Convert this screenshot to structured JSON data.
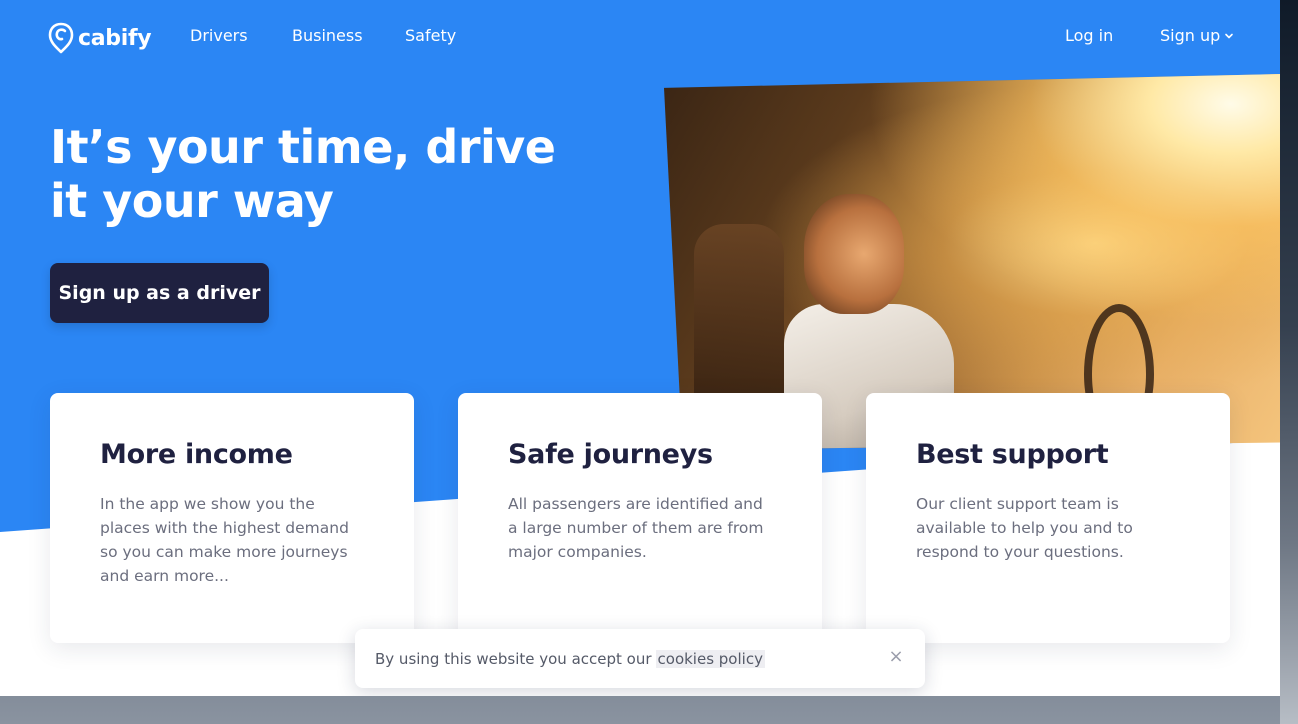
{
  "nav": {
    "logo_text": "cabify",
    "links": [
      "Drivers",
      "Business",
      "Safety"
    ],
    "login": "Log in",
    "signup": "Sign up"
  },
  "hero": {
    "title_line1": "It’s your time, drive",
    "title_line2": "it your way",
    "cta": "Sign up as a driver"
  },
  "cards": [
    {
      "title": "More income",
      "body": "In the app we show you the places with the highest demand so you can make more journeys and earn more..."
    },
    {
      "title": "Safe journeys",
      "body": "All passengers are identified and a large number of them are from major companies."
    },
    {
      "title": "Best support",
      "body": "Our client support team is available to help you and to respond to your questions."
    }
  ],
  "cookie": {
    "text": "By using this website you accept our",
    "link": "cookies policy",
    "close": "×"
  },
  "colors": {
    "brand_blue": "#2b86f4",
    "cta_dark": "#1f2140"
  },
  "icons": {
    "logo": "cabify-logo-icon",
    "signup_chevron": "chevron-down-icon",
    "close": "close-icon"
  }
}
